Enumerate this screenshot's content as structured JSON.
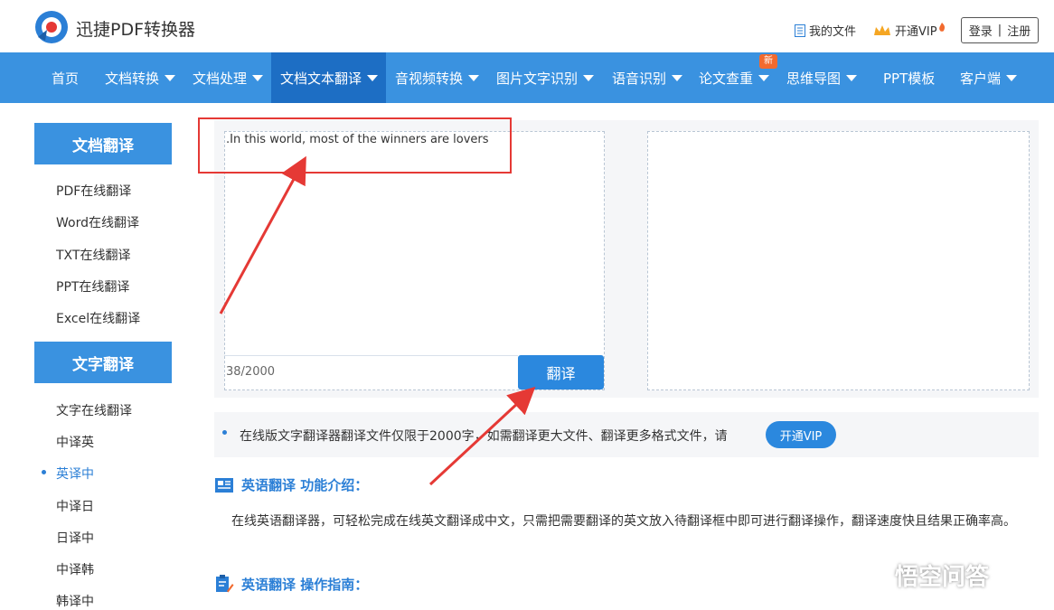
{
  "header": {
    "app_title": "迅捷PDF转换器",
    "my_files": "我的文件",
    "vip": "开通VIP",
    "login": "登录",
    "separator": "|",
    "register": "注册"
  },
  "nav": {
    "items": [
      {
        "label": "首页",
        "dropdown": false
      },
      {
        "label": "文档转换",
        "dropdown": true
      },
      {
        "label": "文档处理",
        "dropdown": true
      },
      {
        "label": "文档文本翻译",
        "dropdown": true,
        "active": true
      },
      {
        "label": "音视频转换",
        "dropdown": true
      },
      {
        "label": "图片文字识别",
        "dropdown": true
      },
      {
        "label": "语音识别",
        "dropdown": true
      },
      {
        "label": "论文查重",
        "dropdown": true
      },
      {
        "label": "思维导图",
        "dropdown": true
      },
      {
        "label": "PPT模板",
        "dropdown": false
      },
      {
        "label": "客户端",
        "dropdown": true
      }
    ],
    "new_badge": "新"
  },
  "sidebar": {
    "doc_heading": "文档翻译",
    "doc_items": [
      "PDF在线翻译",
      "Word在线翻译",
      "TXT在线翻译",
      "PPT在线翻译",
      "Excel在线翻译"
    ],
    "text_heading": "文字翻译",
    "text_items": [
      "文字在线翻译",
      "中译英",
      "英译中",
      "中译日",
      "日译中",
      "中译韩",
      "韩译中"
    ]
  },
  "translator": {
    "input_value": ".In this world, most of the winners are lovers",
    "counter": "38/2000",
    "translate_button": "翻译",
    "output_value": ""
  },
  "notice": {
    "text": "在线版文字翻译器翻译文件仅限于2000字，如需翻译更大文件、翻译更多格式文件，请",
    "vip_button": "开通VIP"
  },
  "intro": {
    "title": "英语翻译 功能介绍：",
    "body": "在线英语翻译器，可轻松完成在线英文翻译成中文，只需把需要翻译的英文放入待翻译框中即可进行翻译操作，翻译速度快且结果正确率高。"
  },
  "guide": {
    "title": "英语翻译 操作指南："
  },
  "watermark": "悟空问答",
  "colors": {
    "primary": "#3a92e0",
    "nav_active": "#1d6ec4",
    "button": "#2b88de",
    "highlight": "#e53935",
    "badge": "#f26a2e"
  }
}
